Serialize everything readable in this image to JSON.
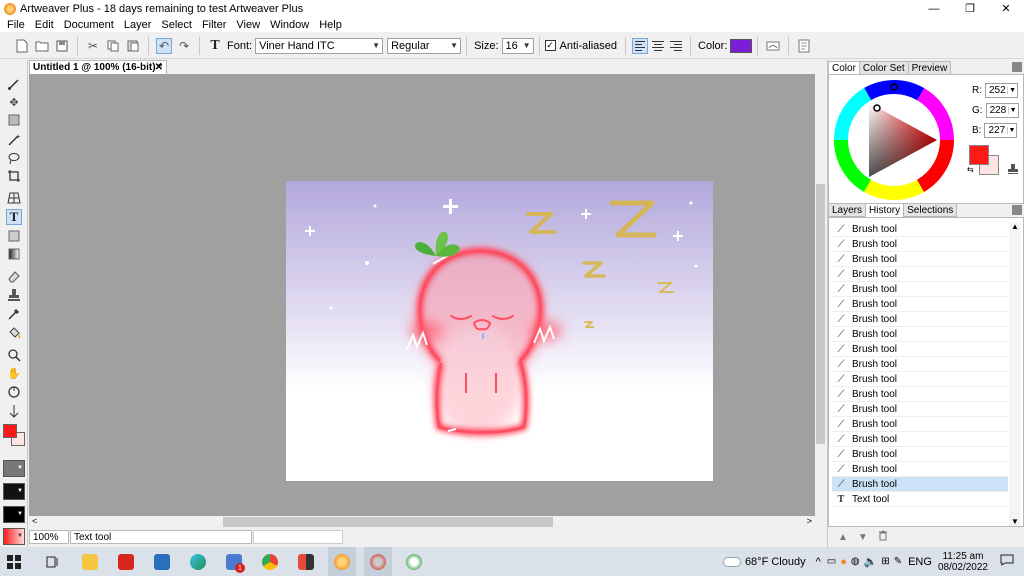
{
  "window": {
    "title": "Artweaver Plus - 18 days remaining to test Artweaver Plus",
    "minimize": "—",
    "maximize": "❐",
    "close": "✕"
  },
  "menu": [
    "File",
    "Edit",
    "Document",
    "Layer",
    "Select",
    "Filter",
    "View",
    "Window",
    "Help"
  ],
  "toolbar": {
    "font_label": "Font:",
    "font_value": "Viner Hand ITC",
    "style_value": "Regular",
    "size_label": "Size:",
    "size_value": "16",
    "antialias_label": "Anti-aliased",
    "antialias_checked": "✓",
    "color_label": "Color:",
    "color_value": "#7a1fd6"
  },
  "document": {
    "tab_title": "Untitled 1 @ 100% (16-bit) *",
    "tab_close": "✕",
    "zoom": "100%",
    "status_tool": "Text tool"
  },
  "artwork_text": {
    "z1": "Z",
    "z2": "Z",
    "z3": "Z",
    "z4": "Z",
    "z5": "z"
  },
  "color_panel": {
    "tabs": [
      "Color",
      "Color Set",
      "Preview"
    ],
    "r_label": "R:",
    "r_value": "252",
    "g_label": "G:",
    "g_value": "228",
    "b_label": "B:",
    "b_value": "227",
    "foreground": "#ff1a1a",
    "background": "#fce4e3"
  },
  "history_panel": {
    "tabs": [
      "Layers",
      "History",
      "Selections"
    ],
    "items": [
      "Brush tool",
      "Brush tool",
      "Brush tool",
      "Brush tool",
      "Brush tool",
      "Brush tool",
      "Brush tool",
      "Brush tool",
      "Brush tool",
      "Brush tool",
      "Brush tool",
      "Brush tool",
      "Brush tool",
      "Brush tool",
      "Brush tool",
      "Brush tool",
      "Brush tool",
      "Brush tool",
      "Text tool"
    ],
    "selected_index": 17
  },
  "taskbar": {
    "weather": "68°F  Cloudy",
    "language": "ENG",
    "time": "11:25 am",
    "date": "08/02/2022",
    "badge": "1"
  }
}
